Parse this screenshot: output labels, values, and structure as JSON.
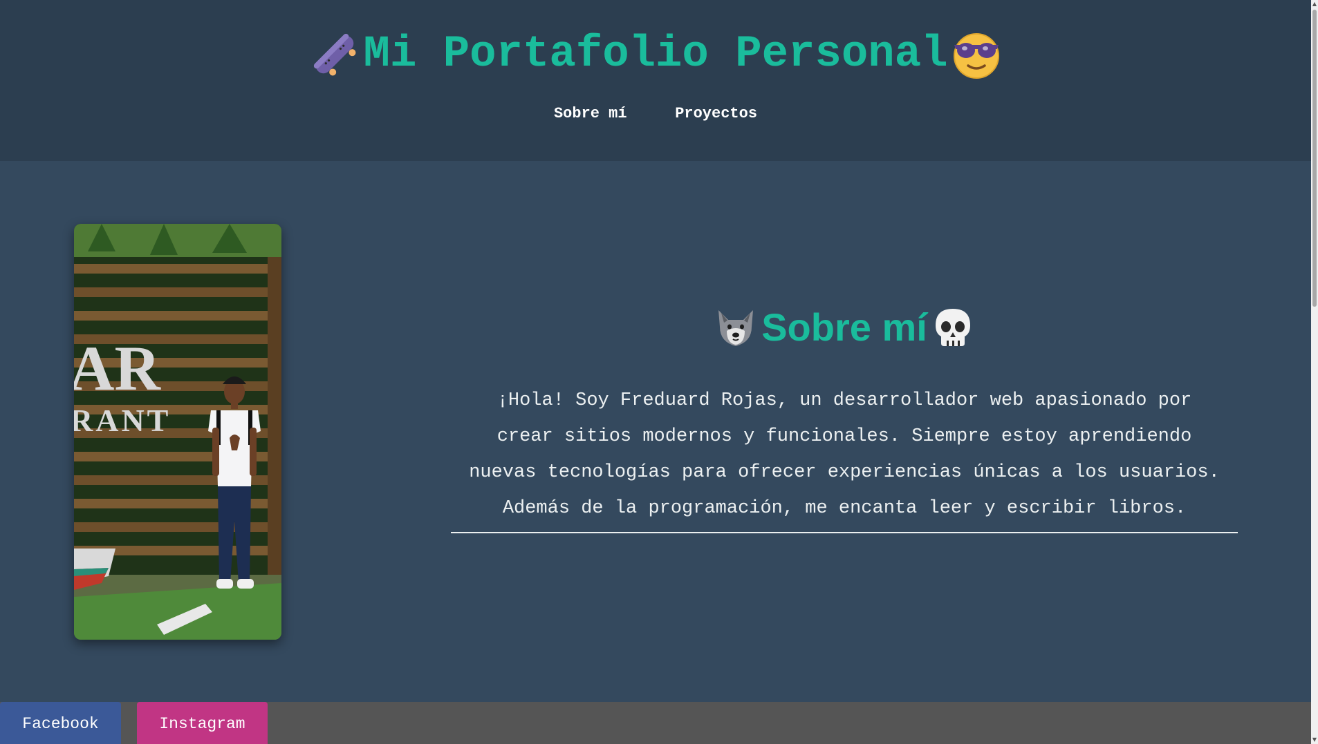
{
  "header": {
    "title": "Mi Portafolio Personal",
    "left_emoji": "skateboard-icon",
    "right_emoji": "sunglasses-face-icon",
    "nav": [
      {
        "label": "Sobre mí"
      },
      {
        "label": "Proyectos"
      }
    ]
  },
  "photo": {
    "sign_letters": "AR",
    "sign_subtext": "RANT"
  },
  "about": {
    "heading": "Sobre mí",
    "left_emoji": "wolf-icon",
    "right_emoji": "skull-icon",
    "text": "¡Hola! Soy Freduard Rojas, un desarrollador web apasionado por crear sitios modernos y funcionales. Siempre estoy aprendiendo nuevas tecnologías para ofrecer experiencias únicas a los usuarios. Además de la programación, me encanta leer y escribir libros."
  },
  "footer": {
    "links": [
      {
        "label": "Facebook",
        "color": "#3b5998"
      },
      {
        "label": "Instagram",
        "color": "#c13584"
      }
    ]
  },
  "colors": {
    "accent": "#1abc9c",
    "header_bg": "#2c3e50",
    "body_bg": "#34495e",
    "footer_bg": "#555555"
  }
}
